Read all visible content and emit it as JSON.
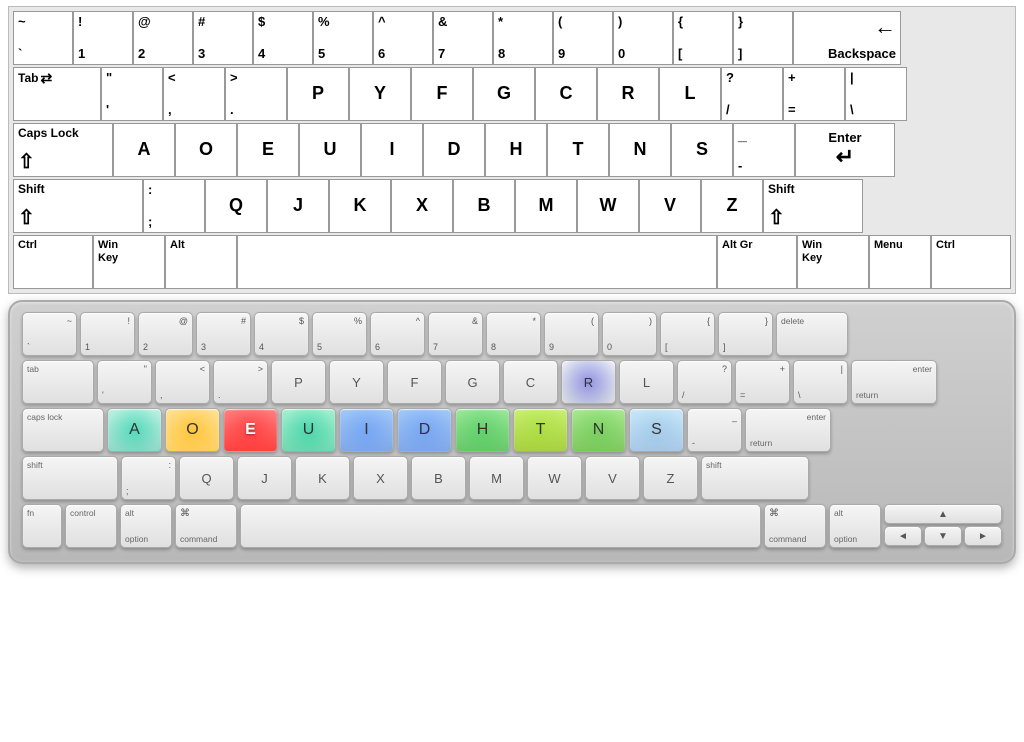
{
  "top_keyboard": {
    "rows": [
      {
        "id": "row1",
        "keys": [
          {
            "id": "tilde",
            "top": "~",
            "bot": "`",
            "w": "std"
          },
          {
            "id": "1",
            "top": "!",
            "bot": "1",
            "w": "std"
          },
          {
            "id": "2",
            "top": "@",
            "bot": "2",
            "w": "std"
          },
          {
            "id": "3",
            "top": "#",
            "bot": "3",
            "w": "std"
          },
          {
            "id": "4",
            "top": "$",
            "bot": "4",
            "w": "std"
          },
          {
            "id": "5",
            "top": "%",
            "bot": "5",
            "w": "std"
          },
          {
            "id": "6",
            "top": "^",
            "bot": "6",
            "w": "std"
          },
          {
            "id": "7",
            "top": "&",
            "bot": "7",
            "w": "std"
          },
          {
            "id": "8",
            "top": "*",
            "bot": "8",
            "w": "std"
          },
          {
            "id": "9",
            "top": "(",
            "bot": "9",
            "w": "std"
          },
          {
            "id": "0",
            "top": ")",
            "bot": "0",
            "w": "std"
          },
          {
            "id": "lbracket",
            "top": "{",
            "bot": "[",
            "w": "std"
          },
          {
            "id": "rbracket",
            "top": "}",
            "bot": "]",
            "w": "std"
          },
          {
            "id": "backspace",
            "label": "Backspace",
            "w": "backspace"
          }
        ]
      },
      {
        "id": "row2",
        "keys": [
          {
            "id": "tab",
            "label": "Tab",
            "w": "tab"
          },
          {
            "id": "dquote",
            "top": "\"",
            "bot": "'",
            "w": "std"
          },
          {
            "id": "lt",
            "top": "<",
            "bot": ",",
            "w": "std"
          },
          {
            "id": "gt",
            "top": ">",
            "bot": ".",
            "w": "std"
          },
          {
            "id": "P",
            "char": "P",
            "w": "std"
          },
          {
            "id": "Y",
            "char": "Y",
            "w": "std"
          },
          {
            "id": "F",
            "char": "F",
            "w": "std"
          },
          {
            "id": "G",
            "char": "G",
            "w": "std"
          },
          {
            "id": "C",
            "char": "C",
            "w": "std"
          },
          {
            "id": "R",
            "char": "R",
            "w": "std"
          },
          {
            "id": "L",
            "char": "L",
            "w": "std"
          },
          {
            "id": "qmark",
            "top": "?",
            "bot": "/",
            "w": "std"
          },
          {
            "id": "plus",
            "top": "+",
            "bot": "=",
            "w": "std"
          },
          {
            "id": "pipe",
            "char": "|",
            "bot": "\\",
            "w": "std"
          }
        ]
      },
      {
        "id": "row3",
        "keys": [
          {
            "id": "capslock",
            "label": "Caps Lock",
            "w": "caps"
          },
          {
            "id": "A",
            "char": "A",
            "w": "std"
          },
          {
            "id": "O",
            "char": "O",
            "w": "std"
          },
          {
            "id": "E",
            "char": "E",
            "w": "std"
          },
          {
            "id": "U",
            "char": "U",
            "w": "std"
          },
          {
            "id": "I",
            "char": "I",
            "w": "std"
          },
          {
            "id": "D",
            "char": "D",
            "w": "std"
          },
          {
            "id": "H",
            "char": "H",
            "w": "std"
          },
          {
            "id": "T",
            "char": "T",
            "w": "std"
          },
          {
            "id": "N",
            "char": "N",
            "w": "std"
          },
          {
            "id": "S",
            "char": "S",
            "w": "std"
          },
          {
            "id": "underscore",
            "top": "_",
            "bot": "-",
            "w": "std"
          },
          {
            "id": "enter",
            "label": "Enter",
            "w": "enter"
          }
        ]
      },
      {
        "id": "row4",
        "keys": [
          {
            "id": "shift-l",
            "label": "Shift",
            "w": "shift-l"
          },
          {
            "id": "colon",
            "top": ":",
            "bot": ";",
            "w": "std"
          },
          {
            "id": "Q",
            "char": "Q",
            "w": "std"
          },
          {
            "id": "J",
            "char": "J",
            "w": "std"
          },
          {
            "id": "K",
            "char": "K",
            "w": "std"
          },
          {
            "id": "X",
            "char": "X",
            "w": "std"
          },
          {
            "id": "B",
            "char": "B",
            "w": "std"
          },
          {
            "id": "M",
            "char": "M",
            "w": "std"
          },
          {
            "id": "W",
            "char": "W",
            "w": "std"
          },
          {
            "id": "V",
            "char": "V",
            "w": "std"
          },
          {
            "id": "Z",
            "char": "Z",
            "w": "std"
          },
          {
            "id": "shift-r",
            "label": "Shift",
            "w": "shift-r"
          }
        ]
      },
      {
        "id": "row5",
        "keys": [
          {
            "id": "ctrl-l",
            "label": "Ctrl",
            "w": "ctrl"
          },
          {
            "id": "win-l",
            "label": "Win\nKey",
            "w": "win"
          },
          {
            "id": "alt-l",
            "label": "Alt",
            "w": "alt"
          },
          {
            "id": "space",
            "label": "",
            "w": "space"
          },
          {
            "id": "altgr",
            "label": "Alt Gr",
            "w": "altgr"
          },
          {
            "id": "win-r",
            "label": "Win\nKey",
            "w": "win"
          },
          {
            "id": "menu",
            "label": "Menu",
            "w": "menu"
          },
          {
            "id": "ctrl-r",
            "label": "Ctrl",
            "w": "ctrl"
          }
        ]
      }
    ]
  },
  "bottom_keyboard": {
    "heatmap_keys": [
      "A",
      "O",
      "E",
      "U",
      "I",
      "D",
      "H",
      "T",
      "N",
      "S",
      "R"
    ],
    "heat_levels": {
      "E": "red",
      "O": "orange",
      "A": "teal",
      "U": "teal",
      "I": "blue",
      "D": "blue",
      "H": "green",
      "T": "green",
      "N": "green",
      "S": "light",
      "R": "deepblue"
    }
  }
}
